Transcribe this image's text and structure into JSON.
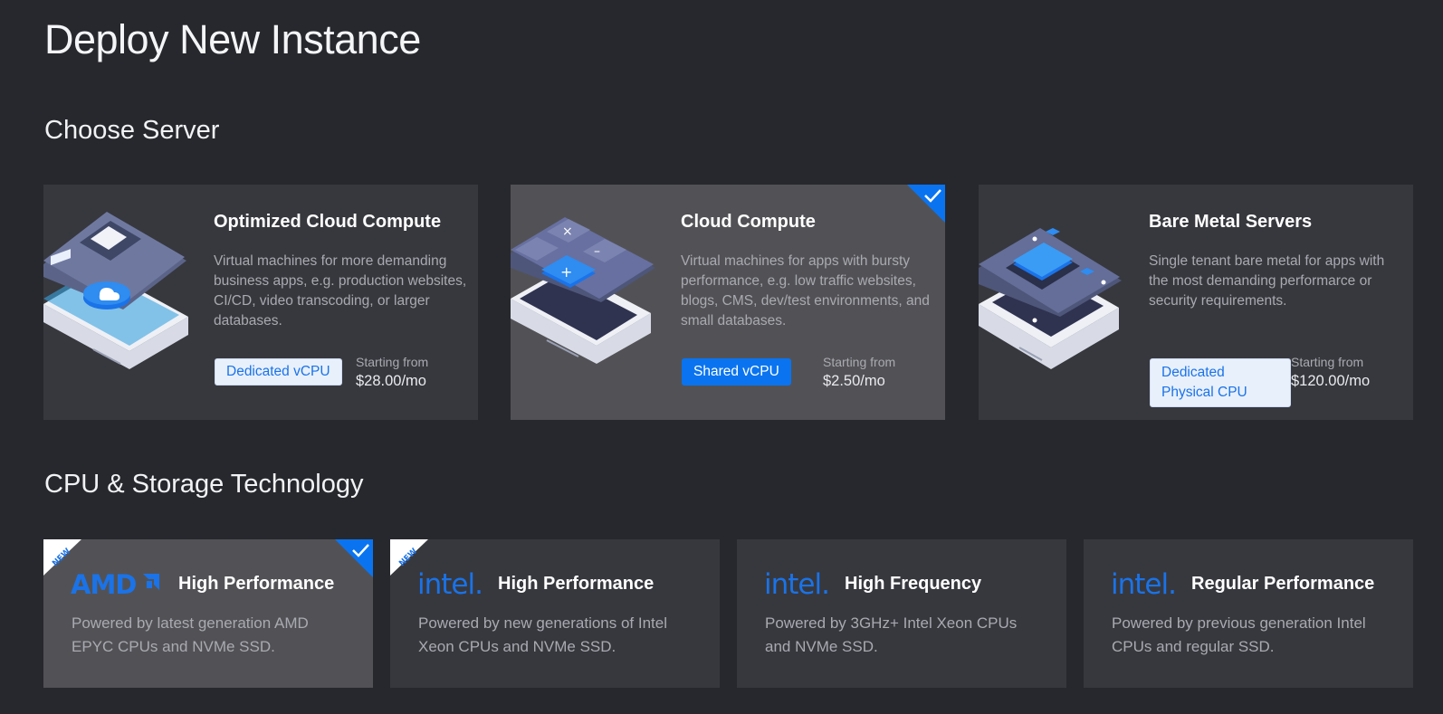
{
  "page": {
    "title": "Deploy New Instance"
  },
  "sections": {
    "server": "Choose Server",
    "cpu": "CPU & Storage Technology"
  },
  "servers": [
    {
      "title": "Optimized Cloud Compute",
      "description": "Virtual machines for more demanding business apps, e.g. production websites, CI/CD, video transcoding, or larger databases.",
      "badge": "Dedicated vCPU",
      "price_label": "Starting from",
      "price": "$28.00/mo",
      "selected": false
    },
    {
      "title": "Cloud Compute",
      "description": "Virtual machines for apps with bursty performance, e.g. low traffic websites, blogs, CMS, dev/test environments, and small databases.",
      "badge": "Shared vCPU",
      "price_label": "Starting from",
      "price": "$2.50/mo",
      "selected": true
    },
    {
      "title": "Bare Metal Servers",
      "description": "Single tenant bare metal for apps with the most demanding performarce or security requirements.",
      "badge": "Dedicated Physical CPU",
      "price_label": "Starting from",
      "price": "$120.00/mo",
      "selected": false
    }
  ],
  "cpu_options": [
    {
      "brand": "AMD",
      "title": "High Performance",
      "description": "Powered by latest generation AMD EPYC CPUs and NVMe SSD.",
      "ribbon": "NEW",
      "selected": true
    },
    {
      "brand": "intel.",
      "title": "High Performance",
      "description": "Powered by new generations of Intel Xeon CPUs and NVMe SSD.",
      "ribbon": "NEW",
      "selected": false
    },
    {
      "brand": "intel.",
      "title": "High Frequency",
      "description": "Powered by 3GHz+ Intel Xeon CPUs and NVMe SSD.",
      "ribbon": "",
      "selected": false
    },
    {
      "brand": "intel.",
      "title": "Regular Performance",
      "description": "Powered by previous generation Intel CPUs and regular SSD.",
      "ribbon": "",
      "selected": false
    }
  ],
  "colors": {
    "background": "#27282d",
    "card": "#37383e",
    "card_selected": "#525256",
    "accent": "#0a74f0",
    "brand_blue": "#1a73e8"
  },
  "icons": {
    "check": "checkmark-icon",
    "illus_optimized": "server-cloud-chip-illustration",
    "illus_cloud": "server-calculator-illustration",
    "illus_baremetal": "server-cpu-die-illustration"
  }
}
